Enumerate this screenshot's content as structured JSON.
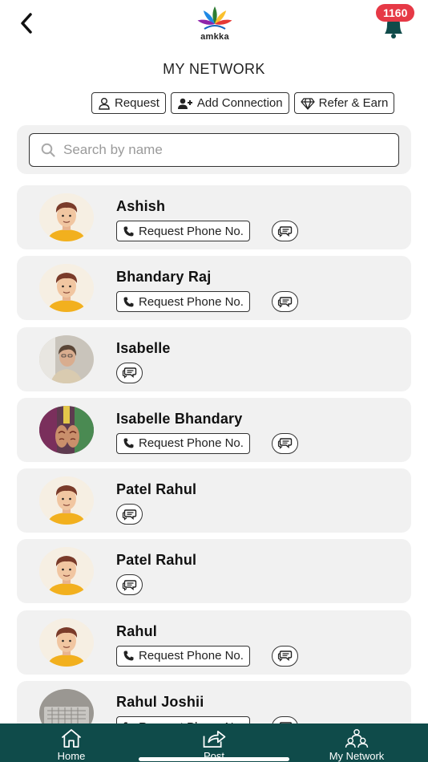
{
  "header": {
    "back_icon": "chevron-left-icon",
    "logo_text": "amkka",
    "notification_count": "1160",
    "bell_icon": "bell-icon"
  },
  "page": {
    "title": "MY NETWORK"
  },
  "actions": {
    "request_label": "Request",
    "add_connection_label": "Add Connection",
    "refer_label": "Refer & Earn"
  },
  "search": {
    "placeholder": "Search by name",
    "value": ""
  },
  "contacts": [
    {
      "name": "Ashish",
      "avatar": "cartoon-man",
      "request_phone": "Request Phone No."
    },
    {
      "name": "Bhandary Raj",
      "avatar": "cartoon-man",
      "request_phone": "Request Phone No."
    },
    {
      "name": "Isabelle",
      "avatar": "photo-woman",
      "request_phone": ""
    },
    {
      "name": "Isabelle Bhandary",
      "avatar": "photo-hands",
      "request_phone": "Request Phone No."
    },
    {
      "name": "Patel Rahul",
      "avatar": "cartoon-man",
      "request_phone": ""
    },
    {
      "name": "Patel Rahul",
      "avatar": "cartoon-man",
      "request_phone": ""
    },
    {
      "name": "Rahul",
      "avatar": "cartoon-man",
      "request_phone": "Request Phone No."
    },
    {
      "name": "Rahul Joshii",
      "avatar": "photo-keyboard",
      "request_phone": "Request Phone No."
    }
  ],
  "bottom_nav": [
    {
      "label": "Home",
      "icon": "home-icon"
    },
    {
      "label": "Post",
      "icon": "share-icon"
    },
    {
      "label": "My Network",
      "icon": "network-icon"
    }
  ],
  "colors": {
    "nav_background": "#0f4b4a",
    "badge": "#e63946",
    "card_background": "#f1f1f1",
    "avatar_shirt": "#f2b01e"
  }
}
